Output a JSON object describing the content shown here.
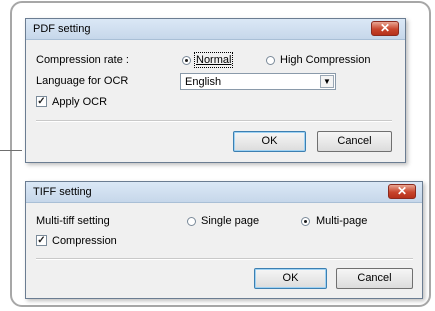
{
  "pdf_dialog": {
    "title": "PDF setting",
    "close_glyph": "✕",
    "compression_label": "Compression rate :",
    "radio_normal": "Normal",
    "radio_high": "High Compression",
    "language_label": "Language for OCR",
    "language_value": "English",
    "apply_ocr_label": "Apply OCR",
    "ok_label": "OK",
    "cancel_label": "Cancel"
  },
  "tiff_dialog": {
    "title": "TIFF setting",
    "close_glyph": "✕",
    "multitiff_label": "Multi-tiff setting",
    "radio_single": "Single page",
    "radio_multi": "Multi-page",
    "compression_label": "Compression",
    "ok_label": "OK",
    "cancel_label": "Cancel"
  },
  "icons": {
    "close": "close-icon",
    "dropdown": "chevron-down-icon",
    "check": "checkmark-icon"
  }
}
